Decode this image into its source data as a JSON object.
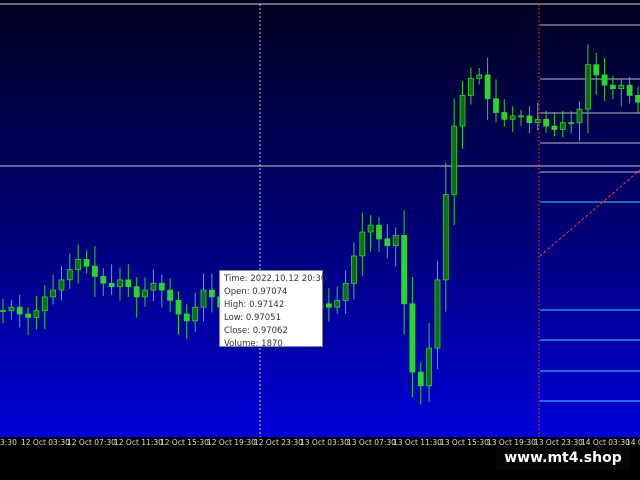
{
  "colors": {
    "candle": "#2cd42c",
    "candle_dark": "#0d6f0d",
    "grid_line": "#b8b8c8",
    "crosshair": "#d0d0d0",
    "level_line": "#4fd0ff",
    "trend_line": "#ff3030",
    "plot_bg_top": "#00001e",
    "plot_bg_bottom": "#0000d8"
  },
  "tooltip": {
    "time": "Time: 2022.10.12 20:30",
    "open": "Open: 0.97074",
    "high": "High: 0.97142",
    "low": "Low:  0.97051",
    "close": "Close: 0.97062",
    "volume": "Volume: 1870"
  },
  "time_axis": [
    "12 Oct 03:30",
    "12 Oct 07:30",
    "12 Oct 11:30",
    "12 Oct 15:30",
    "12 Oct 19:30",
    "12 Oct 23:30",
    "13 Oct 03:30",
    "13 Oct 07:30",
    "13 Oct 11:30",
    "13 Oct 15:30",
    "13 Oct 19:30",
    "13 Oct 23:30",
    "14 Oct 03:30",
    "14 O"
  ],
  "first_tick_fragment": "3:30",
  "watermark": "www.mt4.shop",
  "chart_data": {
    "type": "candlestick",
    "series": [
      {
        "values": [
          0.9677,
          0.9678,
          0.9676,
          0.9675,
          0.9677,
          0.9681,
          0.9683,
          0.9686,
          0.9689,
          0.9692,
          0.969,
          0.9687,
          0.9685,
          0.9684,
          0.9686,
          0.9684,
          0.9681,
          0.9683,
          0.9685,
          0.9683,
          0.968,
          0.9676,
          0.9674,
          0.9678,
          0.9683,
          0.9681,
          0.9678,
          0.968,
          0.9682,
          0.9681,
          0.9679,
          0.9681,
          0.9683,
          0.9684,
          0.9681,
          0.9679,
          0.968,
          0.9678,
          0.9679,
          0.9678,
          0.968,
          0.9685,
          0.9693,
          0.97,
          0.9702,
          0.9698,
          0.9696,
          0.9699,
          0.9679,
          0.9659,
          0.9655,
          0.9666,
          0.9686,
          0.9711,
          0.9731,
          0.974,
          0.9745,
          0.9746,
          0.9739,
          0.9735,
          0.9733,
          0.9734,
          0.9734,
          0.9732,
          0.9733,
          0.9731,
          0.973,
          0.9732,
          0.9732,
          0.9736,
          0.9749,
          0.9746,
          0.9743,
          0.9742,
          0.9743,
          0.974,
          0.9738
        ]
      }
    ]
  }
}
